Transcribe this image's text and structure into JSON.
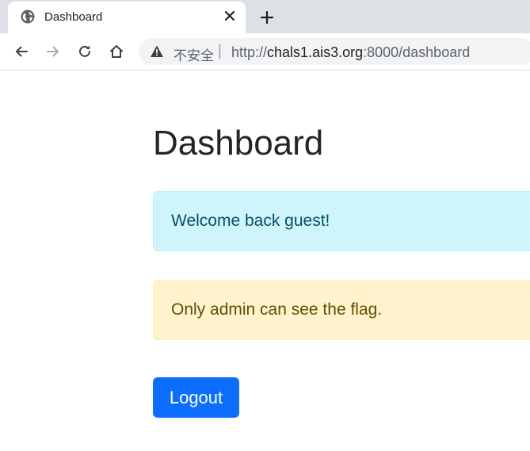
{
  "browser": {
    "tab": {
      "title": "Dashboard",
      "favicon": "globe-icon"
    },
    "toolbar": {
      "security_label": "不安全",
      "separator": "|",
      "url_scheme": "http://",
      "url_host": "chals1.ais3.org",
      "url_rest": ":8000/dashboard"
    },
    "colors": {
      "tab_strip": "#dee1e6",
      "omnibox": "#f1f3f4"
    }
  },
  "page": {
    "title": "Dashboard",
    "alerts": [
      {
        "type": "info",
        "text": "Welcome back guest!"
      },
      {
        "type": "warning",
        "text": "Only admin can see the flag."
      }
    ],
    "logout_label": "Logout",
    "colors": {
      "primary": "#0d6efd",
      "info_bg": "#cff4fc",
      "info_text": "#055160",
      "warning_bg": "#fff3cd",
      "warning_text": "#664d03"
    }
  }
}
